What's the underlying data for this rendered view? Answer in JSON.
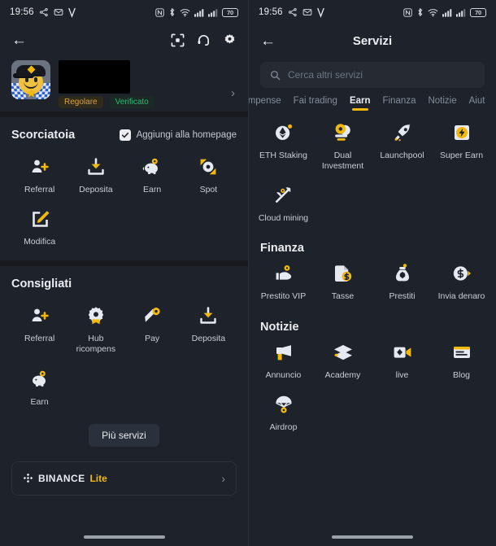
{
  "status_bar": {
    "time": "19:56",
    "battery": "70",
    "left_icons": [
      "share-icon",
      "mail-icon",
      "v-icon"
    ],
    "right_icons": [
      "nfc-icon",
      "bluetooth-icon",
      "wifi-icon",
      "signal-1-icon",
      "signal-2-icon",
      "battery-icon"
    ]
  },
  "left": {
    "header": {
      "back": "←",
      "icons": [
        "scan-icon",
        "headset-icon",
        "gear-icon"
      ]
    },
    "profile": {
      "badge_regular": "Regolare",
      "badge_verified": "Verificato",
      "chevron": "›"
    },
    "shortcut": {
      "title": "Scorciatoia",
      "homepage_label": "Aggiungi alla homepage",
      "homepage_checked": true,
      "items": [
        {
          "label": "Referral",
          "icon": "referral-icon"
        },
        {
          "label": "Deposita",
          "icon": "deposit-icon"
        },
        {
          "label": "Earn",
          "icon": "piggy-bank-icon"
        },
        {
          "label": "Spot",
          "icon": "spot-icon"
        },
        {
          "label": "Modifica",
          "icon": "edit-icon"
        }
      ]
    },
    "recommended": {
      "title": "Consigliati",
      "items": [
        {
          "label": "Referral",
          "icon": "referral-icon"
        },
        {
          "label": "Hub ricompens",
          "icon": "rewards-hub-icon"
        },
        {
          "label": "Pay",
          "icon": "pay-icon"
        },
        {
          "label": "Deposita",
          "icon": "deposit-icon"
        },
        {
          "label": "Earn",
          "icon": "piggy-bank-icon"
        }
      ]
    },
    "more_services_label": "Più servizi",
    "lite_card": {
      "brand": "BINANCE",
      "variant": "Lite",
      "chevron": "›"
    }
  },
  "right": {
    "title": "Servizi",
    "back": "←",
    "search_placeholder": "Cerca altri servizi",
    "tabs": [
      {
        "label": "icompense",
        "active": false
      },
      {
        "label": "Fai trading",
        "active": false
      },
      {
        "label": "Earn",
        "active": true
      },
      {
        "label": "Finanza",
        "active": false
      },
      {
        "label": "Notizie",
        "active": false
      },
      {
        "label": "Aiut",
        "active": false
      }
    ],
    "sections": [
      {
        "title": "",
        "items": [
          {
            "label": "ETH Staking",
            "icon": "eth-staking-icon"
          },
          {
            "label": "Dual Investment",
            "icon": "dual-investment-icon"
          },
          {
            "label": "Launchpool",
            "icon": "rocket-icon"
          },
          {
            "label": "Super Earn",
            "icon": "super-earn-icon"
          },
          {
            "label": "Cloud mining",
            "icon": "pickaxe-icon"
          }
        ]
      },
      {
        "title": "Finanza",
        "items": [
          {
            "label": "Prestito VIP",
            "icon": "vip-loan-icon"
          },
          {
            "label": "Tasse",
            "icon": "tax-icon"
          },
          {
            "label": "Prestiti",
            "icon": "loans-icon"
          },
          {
            "label": "Invia denaro",
            "icon": "send-money-icon"
          }
        ]
      },
      {
        "title": "Notizie",
        "items": [
          {
            "label": "Annuncio",
            "icon": "megaphone-icon"
          },
          {
            "label": "Academy",
            "icon": "graduation-cap-icon"
          },
          {
            "label": "live",
            "icon": "video-camera-icon"
          },
          {
            "label": "Blog",
            "icon": "blog-icon"
          },
          {
            "label": "Airdrop",
            "icon": "parachute-icon"
          }
        ]
      }
    ]
  },
  "colors": {
    "background": "#1e222b",
    "panel_gap": "#181a20",
    "accent_yellow": "#f0b90b",
    "text_primary": "#eaecef",
    "text_secondary": "#858e9c",
    "verified_green": "#2eb873",
    "regular_gold": "#d9a441"
  }
}
